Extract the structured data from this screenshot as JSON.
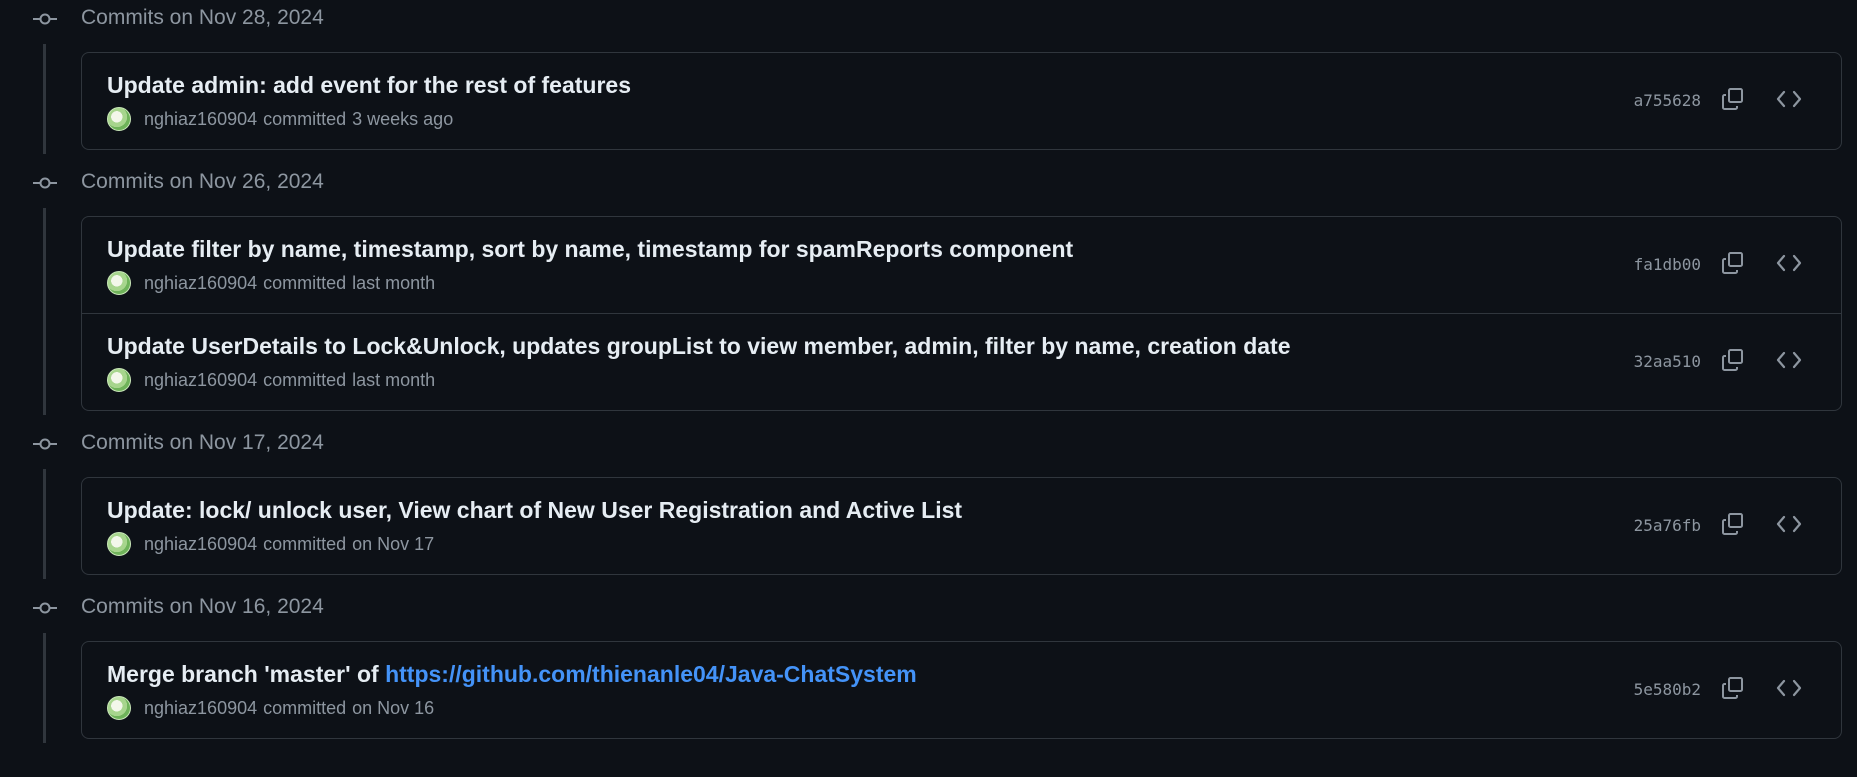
{
  "colors": {
    "background": "#0d1117",
    "border": "#30363d",
    "text_primary": "#e6edf3",
    "text_muted": "#8d96a0",
    "link": "#4493f8"
  },
  "icons": {
    "group": "commit-icon",
    "copy": "copy-icon",
    "browse": "code-icon"
  },
  "groups": [
    {
      "title": "Commits on Nov 28, 2024",
      "commits": [
        {
          "message": "Update admin: add event for the rest of features",
          "author": "nghiaz160904",
          "verb": "committed",
          "when": "3 weeks ago",
          "sha": "a755628"
        }
      ]
    },
    {
      "title": "Commits on Nov 26, 2024",
      "commits": [
        {
          "message": "Update filter by name, timestamp, sort by name, timestamp for spamReports component",
          "author": "nghiaz160904",
          "verb": "committed",
          "when": "last month",
          "sha": "fa1db00"
        },
        {
          "message": "Update UserDetails to Lock&Unlock, updates groupList to view member, admin, filter by name, creation date",
          "author": "nghiaz160904",
          "verb": "committed",
          "when": "last month",
          "sha": "32aa510"
        }
      ]
    },
    {
      "title": "Commits on Nov 17, 2024",
      "commits": [
        {
          "message": "Update: lock/ unlock user, View chart of New User Registration and Active List",
          "author": "nghiaz160904",
          "verb": "committed",
          "when": "on Nov 17",
          "sha": "25a76fb"
        }
      ]
    },
    {
      "title": "Commits on Nov 16, 2024",
      "commits": [
        {
          "message": "Merge branch 'master' of ",
          "link": "https://github.com/thienanle04/Java-ChatSystem",
          "author": "nghiaz160904",
          "verb": "committed",
          "when": "on Nov 16",
          "sha": "5e580b2"
        }
      ]
    }
  ]
}
